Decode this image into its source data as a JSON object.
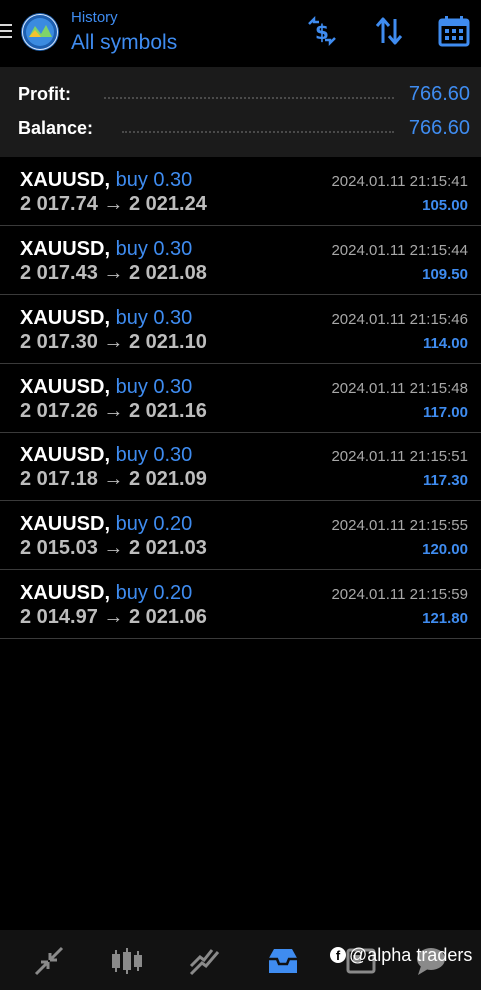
{
  "header": {
    "subtitle": "History",
    "title": "All symbols",
    "icons": [
      "menu-icon",
      "app-logo-icon",
      "currency-exchange-icon",
      "sort-icon",
      "calendar-icon"
    ]
  },
  "summary": {
    "profit_label": "Profit:",
    "profit_value": "766.60",
    "balance_label": "Balance:",
    "balance_value": "766.60"
  },
  "deals": [
    {
      "symbol": "XAUUSD,",
      "side": "buy 0.30",
      "open": "2 017.74",
      "arrow": "→",
      "close": "2 021.24",
      "time": "2024.01.11 21:15:41",
      "profit": "105.00"
    },
    {
      "symbol": "XAUUSD,",
      "side": "buy 0.30",
      "open": "2 017.43",
      "arrow": "→",
      "close": "2 021.08",
      "time": "2024.01.11 21:15:44",
      "profit": "109.50"
    },
    {
      "symbol": "XAUUSD,",
      "side": "buy 0.30",
      "open": "2 017.30",
      "arrow": "→",
      "close": "2 021.10",
      "time": "2024.01.11 21:15:46",
      "profit": "114.00"
    },
    {
      "symbol": "XAUUSD,",
      "side": "buy 0.30",
      "open": "2 017.26",
      "arrow": "→",
      "close": "2 021.16",
      "time": "2024.01.11 21:15:48",
      "profit": "117.00"
    },
    {
      "symbol": "XAUUSD,",
      "side": "buy 0.30",
      "open": "2 017.18",
      "arrow": "→",
      "close": "2 021.09",
      "time": "2024.01.11 21:15:51",
      "profit": "117.30"
    },
    {
      "symbol": "XAUUSD,",
      "side": "buy 0.20",
      "open": "2 015.03",
      "arrow": "→",
      "close": "2 021.03",
      "time": "2024.01.11 21:15:55",
      "profit": "120.00"
    },
    {
      "symbol": "XAUUSD,",
      "side": "buy 0.20",
      "open": "2 014.97",
      "arrow": "→",
      "close": "2 021.06",
      "time": "2024.01.11 21:15:59",
      "profit": "121.80"
    }
  ],
  "bottom_nav": {
    "items": [
      "quotes-icon",
      "chart-icon",
      "trade-icon",
      "history-icon",
      "news-icon",
      "chat-icon"
    ],
    "active": "history-icon"
  },
  "watermark": {
    "badge": "f",
    "text": "@alpha traders"
  },
  "colors": {
    "accent": "#3f8cf0",
    "background": "#000000",
    "summary_background": "#1b1b1b",
    "price_text": "#bdbdbd",
    "time_text": "#a8a8a8",
    "divider": "#3a3a3a"
  }
}
